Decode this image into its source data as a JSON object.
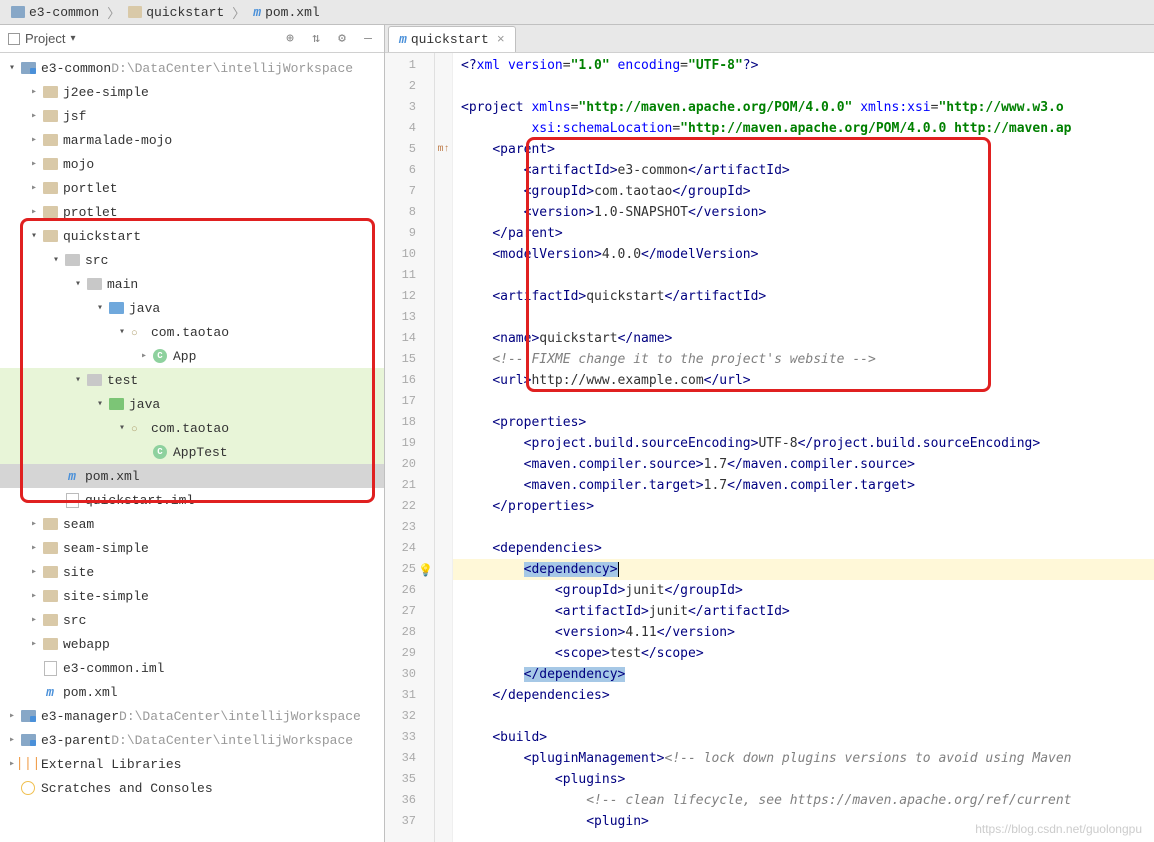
{
  "breadcrumb": {
    "item1": "e3-common",
    "item2": "quickstart",
    "item3": "pom.xml"
  },
  "sidebar": {
    "title": "Project",
    "rows": [
      {
        "indent": 0,
        "arrow": "down",
        "icon": "folder-blue",
        "label": "e3-common",
        "tail": " D:\\DataCenter\\intellijWorkspace"
      },
      {
        "indent": 1,
        "arrow": "right",
        "icon": "folder-open",
        "label": "j2ee-simple"
      },
      {
        "indent": 1,
        "arrow": "right",
        "icon": "folder-open",
        "label": "jsf"
      },
      {
        "indent": 1,
        "arrow": "right",
        "icon": "folder-open",
        "label": "marmalade-mojo"
      },
      {
        "indent": 1,
        "arrow": "right",
        "icon": "folder-open",
        "label": "mojo"
      },
      {
        "indent": 1,
        "arrow": "right",
        "icon": "folder-open",
        "label": "portlet"
      },
      {
        "indent": 1,
        "arrow": "right",
        "icon": "folder-open",
        "label": "protlet"
      },
      {
        "indent": 1,
        "arrow": "down",
        "icon": "folder-open",
        "label": "quickstart"
      },
      {
        "indent": 2,
        "arrow": "down",
        "icon": "folder-gray",
        "label": "src"
      },
      {
        "indent": 3,
        "arrow": "down",
        "icon": "folder-gray",
        "label": "main"
      },
      {
        "indent": 4,
        "arrow": "down",
        "icon": "folder-java",
        "label": "java"
      },
      {
        "indent": 5,
        "arrow": "down",
        "icon": "pkg",
        "label": "com.taotao"
      },
      {
        "indent": 6,
        "arrow": "right",
        "icon": "class",
        "label": "App"
      },
      {
        "indent": 3,
        "arrow": "down",
        "icon": "folder-gray",
        "label": "test",
        "green": true
      },
      {
        "indent": 4,
        "arrow": "down",
        "icon": "folder-green",
        "label": "java",
        "green": true
      },
      {
        "indent": 5,
        "arrow": "down",
        "icon": "pkg",
        "label": "com.taotao",
        "green": true
      },
      {
        "indent": 6,
        "arrow": "none",
        "icon": "class",
        "label": "AppTest",
        "green": true
      },
      {
        "indent": 2,
        "arrow": "none",
        "icon": "m",
        "label": "pom.xml",
        "selected": true
      },
      {
        "indent": 2,
        "arrow": "none",
        "icon": "file",
        "label": "quickstart.iml"
      },
      {
        "indent": 1,
        "arrow": "right",
        "icon": "folder-open",
        "label": "seam"
      },
      {
        "indent": 1,
        "arrow": "right",
        "icon": "folder-open",
        "label": "seam-simple"
      },
      {
        "indent": 1,
        "arrow": "right",
        "icon": "folder-open",
        "label": "site"
      },
      {
        "indent": 1,
        "arrow": "right",
        "icon": "folder-open",
        "label": "site-simple"
      },
      {
        "indent": 1,
        "arrow": "right",
        "icon": "folder-open",
        "label": "src"
      },
      {
        "indent": 1,
        "arrow": "right",
        "icon": "folder-open",
        "label": "webapp"
      },
      {
        "indent": 1,
        "arrow": "none",
        "icon": "file",
        "label": "e3-common.iml"
      },
      {
        "indent": 1,
        "arrow": "none",
        "icon": "m",
        "label": "pom.xml"
      },
      {
        "indent": 0,
        "arrow": "right",
        "icon": "folder-blue",
        "label": "e3-manager",
        "tail": " D:\\DataCenter\\intellijWorkspace"
      },
      {
        "indent": 0,
        "arrow": "right",
        "icon": "folder-blue",
        "label": "e3-parent",
        "tail": " D:\\DataCenter\\intellijWorkspace"
      },
      {
        "indent": 0,
        "arrow": "right",
        "icon": "lib",
        "label": "External Libraries"
      },
      {
        "indent": 0,
        "arrow": "none",
        "icon": "scratch",
        "label": "Scratches and Consoles"
      }
    ]
  },
  "editor": {
    "tab": "quickstart",
    "lines": [
      {
        "n": 1,
        "html": "<span class='tag'>&lt;?</span><span class='attr-name'>xml version</span>=<span class='attr-val'>\"1.0\"</span> <span class='attr-name'>encoding</span>=<span class='attr-val'>\"UTF-8\"</span><span class='tag'>?&gt;</span>"
      },
      {
        "n": 2,
        "html": ""
      },
      {
        "n": 3,
        "html": "<span class='tag'>&lt;project </span><span class='attr-name'>xmlns</span>=<span class='attr-val'>\"http://maven.apache.org/POM/4.0.0\"</span> <span class='attr-name'>xmlns:xsi</span>=<span class='attr-val'>\"http://www.w3.o</span>"
      },
      {
        "n": 4,
        "html": "         <span class='attr-name'>xsi:schemaLocation</span>=<span class='attr-val'>\"http://maven.apache.org/POM/4.0.0 http://maven.ap</span>"
      },
      {
        "n": 5,
        "html": "    <span class='tag'>&lt;parent&gt;</span>",
        "marker": "m↑"
      },
      {
        "n": 6,
        "html": "        <span class='tag'>&lt;artifactId&gt;</span>e3-common<span class='tag'>&lt;/artifactId&gt;</span>"
      },
      {
        "n": 7,
        "html": "        <span class='tag'>&lt;groupId&gt;</span>com.taotao<span class='tag'>&lt;/groupId&gt;</span>"
      },
      {
        "n": 8,
        "html": "        <span class='tag'>&lt;version&gt;</span>1.0-SNAPSHOT<span class='tag'>&lt;/version&gt;</span>"
      },
      {
        "n": 9,
        "html": "    <span class='tag'>&lt;/parent&gt;</span>"
      },
      {
        "n": 10,
        "html": "    <span class='tag'>&lt;modelVersion&gt;</span>4.0.0<span class='tag'>&lt;/modelVersion&gt;</span>"
      },
      {
        "n": 11,
        "html": ""
      },
      {
        "n": 12,
        "html": "    <span class='tag'>&lt;artifactId&gt;</span>quickstart<span class='tag'>&lt;/artifactId&gt;</span>"
      },
      {
        "n": 13,
        "html": ""
      },
      {
        "n": 14,
        "html": "    <span class='tag'>&lt;name&gt;</span>quickstart<span class='tag'>&lt;/name&gt;</span>"
      },
      {
        "n": 15,
        "html": "    <span class='comment'>&lt;!-- FIXME change it to the project's website --&gt;</span>"
      },
      {
        "n": 16,
        "html": "    <span class='tag'>&lt;url&gt;</span>http://www.example.com<span class='tag'>&lt;/url&gt;</span>"
      },
      {
        "n": 17,
        "html": ""
      },
      {
        "n": 18,
        "html": "    <span class='tag'>&lt;properties&gt;</span>"
      },
      {
        "n": 19,
        "html": "        <span class='tag'>&lt;project.build.sourceEncoding&gt;</span>UTF-8<span class='tag'>&lt;/project.build.sourceEncoding&gt;</span>"
      },
      {
        "n": 20,
        "html": "        <span class='tag'>&lt;maven.compiler.source&gt;</span>1.7<span class='tag'>&lt;/maven.compiler.source&gt;</span>"
      },
      {
        "n": 21,
        "html": "        <span class='tag'>&lt;maven.compiler.target&gt;</span>1.7<span class='tag'>&lt;/maven.compiler.target&gt;</span>"
      },
      {
        "n": 22,
        "html": "    <span class='tag'>&lt;/properties&gt;</span>"
      },
      {
        "n": 23,
        "html": ""
      },
      {
        "n": 24,
        "html": "    <span class='tag'>&lt;dependencies&gt;</span>"
      },
      {
        "n": 25,
        "html": "        <span class='sel'><span class='tag'>&lt;dependency&gt;</span></span><span class='cursor'></span>",
        "hl": true,
        "bulb": true
      },
      {
        "n": 26,
        "html": "            <span class='tag'>&lt;groupId&gt;</span>junit<span class='tag'>&lt;/groupId&gt;</span>"
      },
      {
        "n": 27,
        "html": "            <span class='tag'>&lt;artifactId&gt;</span>junit<span class='tag'>&lt;/artifactId&gt;</span>"
      },
      {
        "n": 28,
        "html": "            <span class='tag'>&lt;version&gt;</span>4.11<span class='tag'>&lt;/version&gt;</span>"
      },
      {
        "n": 29,
        "html": "            <span class='tag'>&lt;scope&gt;</span>test<span class='tag'>&lt;/scope&gt;</span>"
      },
      {
        "n": 30,
        "html": "        <span class='sel'><span class='tag'>&lt;/dependency&gt;</span></span>"
      },
      {
        "n": 31,
        "html": "    <span class='tag'>&lt;/dependencies&gt;</span>"
      },
      {
        "n": 32,
        "html": ""
      },
      {
        "n": 33,
        "html": "    <span class='tag'>&lt;build&gt;</span>"
      },
      {
        "n": 34,
        "html": "        <span class='tag'>&lt;pluginManagement&gt;</span><span class='comment'>&lt;!-- lock down plugins versions to avoid using Maven</span>"
      },
      {
        "n": 35,
        "html": "            <span class='tag'>&lt;plugins&gt;</span>"
      },
      {
        "n": 36,
        "html": "                <span class='comment'>&lt;!-- clean lifecycle, see https://maven.apache.org/ref/current</span>"
      },
      {
        "n": 37,
        "html": "                <span class='tag'>&lt;plugin&gt;</span>"
      }
    ]
  },
  "watermark": "https://blog.csdn.net/guolongpu"
}
